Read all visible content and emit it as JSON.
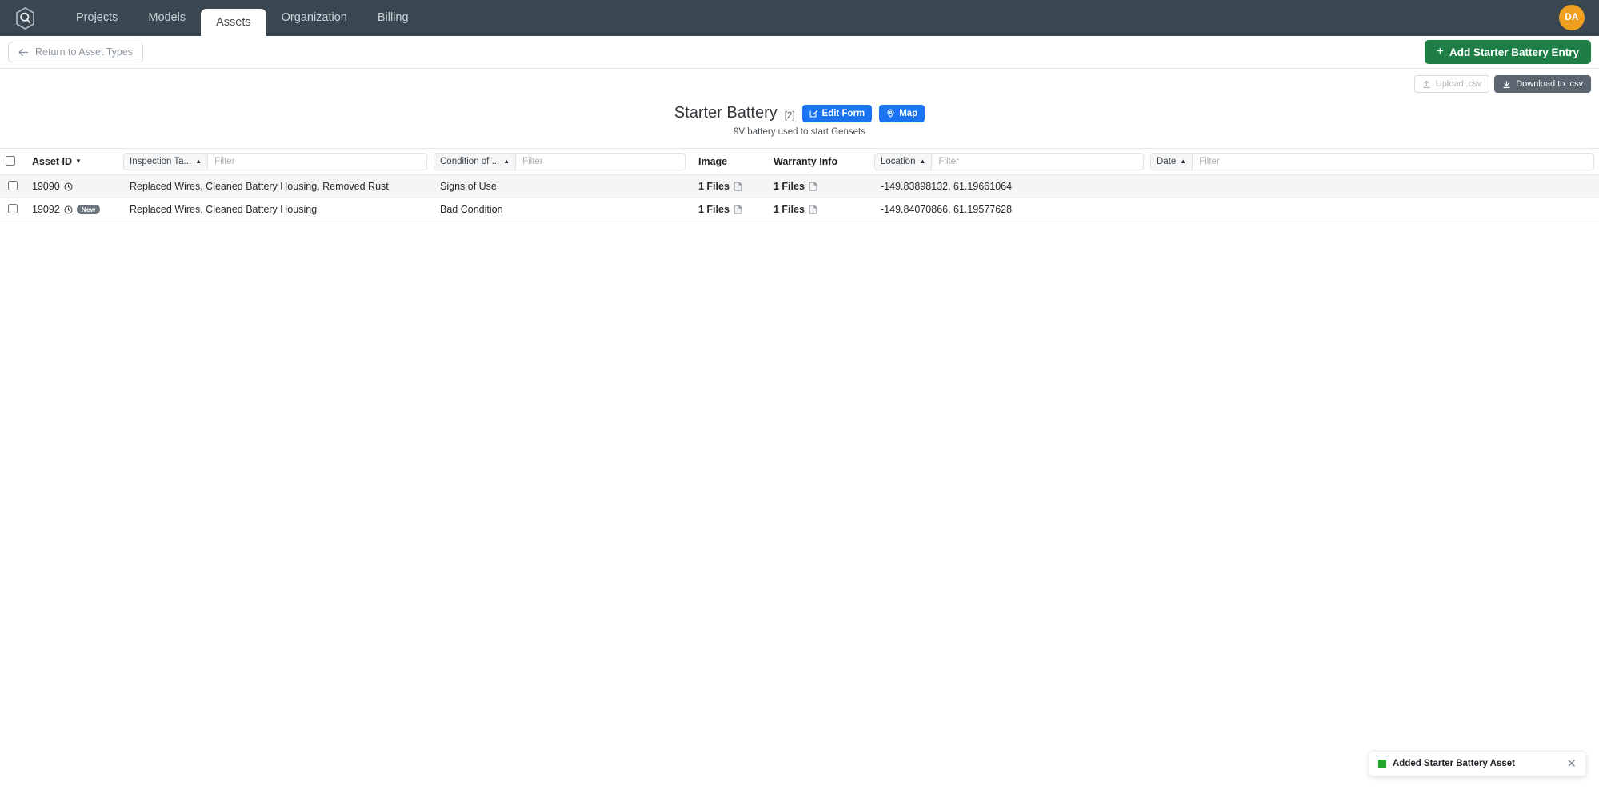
{
  "topnav": {
    "logo_icon": "hexagon-q-logo-icon",
    "tabs": [
      {
        "label": "Projects",
        "active": false
      },
      {
        "label": "Models",
        "active": false
      },
      {
        "label": "Assets",
        "active": true
      },
      {
        "label": "Organization",
        "active": false
      },
      {
        "label": "Billing",
        "active": false
      }
    ],
    "avatar_initials": "DA",
    "avatar_color": "#f0a01e",
    "background_color": "#3a4750"
  },
  "actionbar": {
    "return_label": "Return to Asset Types",
    "return_icon": "arrow-left-icon",
    "add_label": "Add Starter Battery Entry",
    "add_icon": "plus-icon",
    "add_color": "#1e7e46"
  },
  "csvbar": {
    "upload_label": "Upload .csv",
    "upload_icon": "upload-icon",
    "download_label": "Download to .csv",
    "download_icon": "download-icon"
  },
  "title": {
    "name": "Starter Battery",
    "count": "[2]",
    "edit_form_label": "Edit Form",
    "edit_form_icon": "pencil-square-icon",
    "map_label": "Map",
    "map_icon": "map-pin-icon",
    "accent_color": "#1a73f0",
    "description": "9V battery used to start Gensets"
  },
  "table": {
    "columns": [
      {
        "key": "select",
        "type": "checkbox",
        "label": ""
      },
      {
        "key": "asset_id",
        "type": "plain",
        "label": "Asset ID",
        "sort": "down"
      },
      {
        "key": "inspection",
        "type": "filter",
        "label": "Inspection Ta...",
        "sort": "up",
        "placeholder": "Filter",
        "value": ""
      },
      {
        "key": "condition",
        "type": "filter",
        "label": "Condition of ...",
        "sort": "up",
        "placeholder": "Filter",
        "value": ""
      },
      {
        "key": "image",
        "type": "plain",
        "label": "Image",
        "sort": ""
      },
      {
        "key": "warranty",
        "type": "plain",
        "label": "Warranty Info",
        "sort": ""
      },
      {
        "key": "location",
        "type": "filter",
        "label": "Location",
        "sort": "up",
        "placeholder": "Filter",
        "value": ""
      },
      {
        "key": "date",
        "type": "filter",
        "label": "Date",
        "sort": "up",
        "placeholder": "Filter",
        "value": ""
      }
    ],
    "rows": [
      {
        "checked": false,
        "asset_id": "19090",
        "has_clock": true,
        "badge": "",
        "inspection": "Replaced Wires, Cleaned Battery Housing, Removed Rust",
        "condition": "Signs of Use",
        "image": "1 Files",
        "warranty": "1 Files",
        "location": "-149.83898132, 61.19661064",
        "date": ""
      },
      {
        "checked": false,
        "asset_id": "19092",
        "has_clock": true,
        "badge": "New",
        "inspection": "Replaced Wires, Cleaned Battery Housing",
        "condition": "Bad Condition",
        "image": "1 Files",
        "warranty": "1 Files",
        "location": "-149.84070866, 61.19577628",
        "date": ""
      }
    ]
  },
  "toast": {
    "message": "Added Starter Battery Asset",
    "status_color": "#21a52b",
    "close_icon": "close-icon"
  }
}
